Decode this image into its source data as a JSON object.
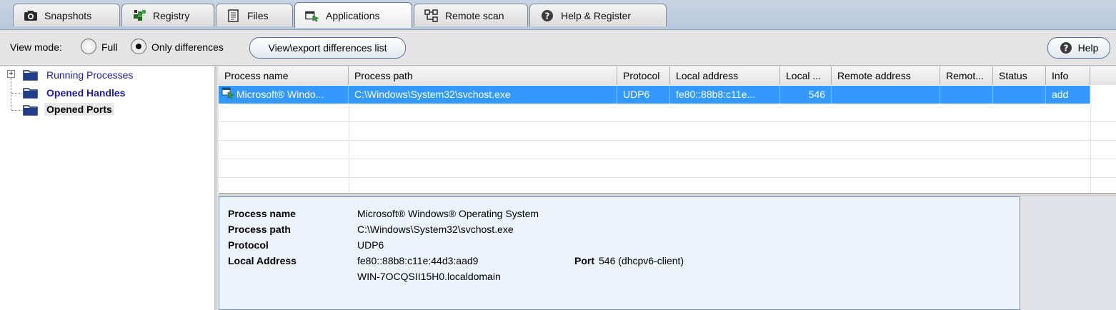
{
  "tabs": [
    {
      "label": "Snapshots",
      "icon": "camera-icon"
    },
    {
      "label": "Registry",
      "icon": "registry-icon"
    },
    {
      "label": "Files",
      "icon": "file-icon"
    },
    {
      "label": "Applications",
      "icon": "applications-icon",
      "active": true
    },
    {
      "label": "Remote scan",
      "icon": "network-icon"
    },
    {
      "label": "Help & Register",
      "icon": "help-icon"
    }
  ],
  "toolbar": {
    "view_mode_label": "View mode:",
    "radio_full": "Full",
    "radio_diff": "Only differences",
    "selected_mode": "Only differences",
    "export_button": "View\\export differences list",
    "help_button": "Help"
  },
  "tree": {
    "items": [
      {
        "label": "Running Processes",
        "expandable": true,
        "color": "#1a1aa6"
      },
      {
        "label": "Opened Handles",
        "expandable": false,
        "color": "#1a1aa6"
      },
      {
        "label": "Opened Ports",
        "expandable": false,
        "selected": true,
        "color": "#000000"
      }
    ]
  },
  "grid": {
    "columns": [
      "Process name",
      "Process path",
      "Protocol",
      "Local address",
      "Local ...",
      "Remote address",
      "Remot...",
      "Status",
      "Info"
    ],
    "rows": [
      {
        "process_name": "Microsoft® Windo...",
        "process_path": "C:\\Windows\\System32\\svchost.exe",
        "protocol": "UDP6",
        "local_address": "fe80::88b8:c11e...",
        "local_port": "546",
        "remote_address": "",
        "remote_port": "",
        "status": "",
        "info": "add"
      }
    ],
    "selection_color": "#3399ff"
  },
  "detail": {
    "process_name_label": "Process name",
    "process_name": "Microsoft® Windows® Operating System",
    "process_path_label": "Process path",
    "process_path": "C:\\Windows\\System32\\svchost.exe",
    "protocol_label": "Protocol",
    "protocol": "UDP6",
    "local_address_label": "Local Address",
    "local_address": "fe80::88b8:c11e:44d3:aad9",
    "host_name": "WIN-7OCQSII15H0.localdomain",
    "port_label": "Port",
    "port_value": "546 (dhcpv6-client)"
  }
}
